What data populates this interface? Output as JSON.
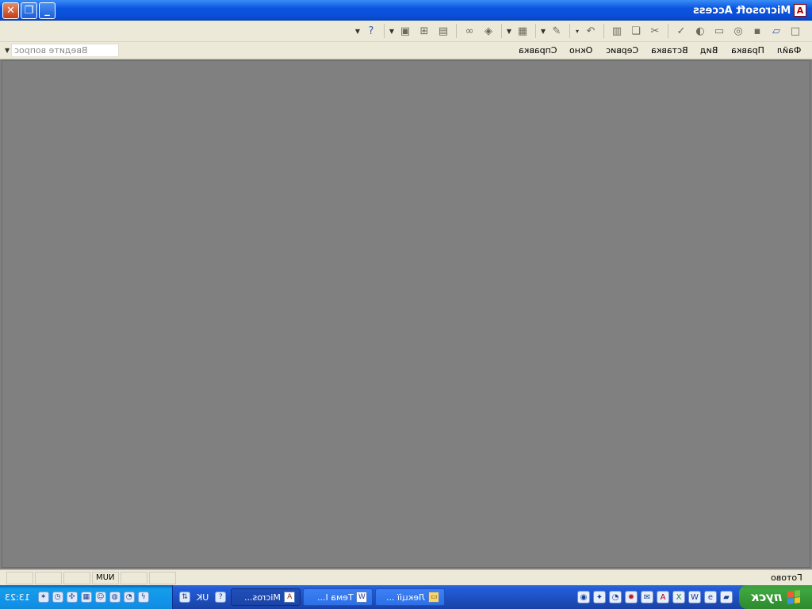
{
  "window": {
    "title": "Microsoft Access",
    "controls": [
      "close",
      "restore",
      "minimize"
    ]
  },
  "menubar": {
    "items": [
      {
        "label": "Файл"
      },
      {
        "label": "Правка"
      },
      {
        "label": "Вид"
      },
      {
        "label": "Вставка"
      },
      {
        "label": "Сервис"
      },
      {
        "label": "Окно"
      },
      {
        "label": "Справка"
      }
    ],
    "ask_placeholder": "Введите вопрос"
  },
  "statusbar": {
    "status_text": "Готово",
    "num_indicator": "NUM"
  },
  "taskbar": {
    "start_label": "пуск",
    "tasks": [
      {
        "label": "Лекції ..."
      },
      {
        "label": "Тема І..."
      },
      {
        "label": "Micros..."
      }
    ],
    "language": "UK",
    "clock": "13:23"
  }
}
